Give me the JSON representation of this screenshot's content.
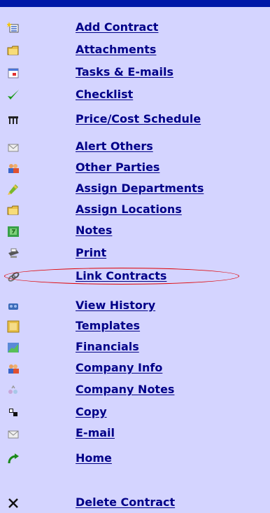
{
  "colors": {
    "panel_background": "#d4d4ff",
    "top_bar": "#0018a8",
    "link_text": "#000088",
    "highlight_ring": "#e00000"
  },
  "menu": {
    "highlighted_item": "Link Contracts",
    "items": [
      {
        "label": "Add Contract",
        "icon": "add-contract-icon"
      },
      {
        "label": "Attachments",
        "icon": "folder-icon"
      },
      {
        "label": "Tasks & E-mails",
        "icon": "calendar-icon"
      },
      {
        "label": "Checklist",
        "icon": "checkmark-icon"
      },
      {
        "label": "Price/Cost Schedule",
        "icon": "table-icon"
      },
      {
        "label": "Alert Others",
        "icon": "envelope-icon"
      },
      {
        "label": "Other Parties",
        "icon": "people-icon"
      },
      {
        "label": "Assign Departments",
        "icon": "pencil-icon"
      },
      {
        "label": "Assign Locations",
        "icon": "folder-icon"
      },
      {
        "label": "Notes",
        "icon": "notes-icon"
      },
      {
        "label": "Print",
        "icon": "printer-icon"
      },
      {
        "label": "Link Contracts",
        "icon": "link-icon"
      },
      {
        "label": "View History",
        "icon": "history-icon"
      },
      {
        "label": "Templates",
        "icon": "templates-icon"
      },
      {
        "label": "Financials",
        "icon": "chart-icon"
      },
      {
        "label": "Company Info",
        "icon": "people-icon"
      },
      {
        "label": "Company Notes",
        "icon": "company-notes-icon"
      },
      {
        "label": "Copy",
        "icon": "copy-icon"
      },
      {
        "label": "E-mail",
        "icon": "envelope-icon"
      },
      {
        "label": "Home",
        "icon": "home-arrow-icon"
      },
      {
        "label": "Delete Contract",
        "icon": "delete-x-icon"
      }
    ]
  }
}
